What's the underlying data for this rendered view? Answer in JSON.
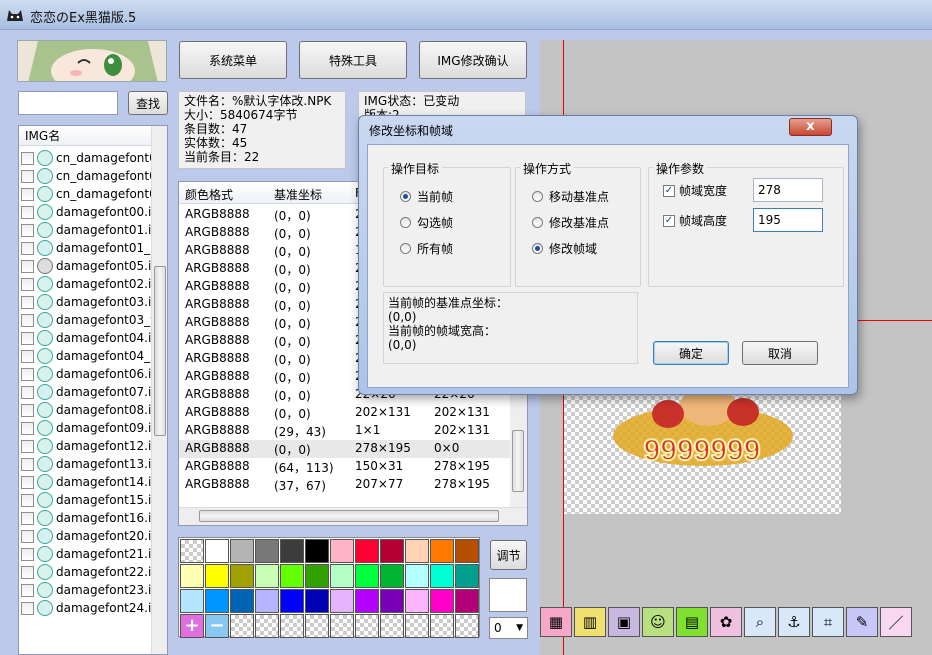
{
  "window": {
    "title": "恋恋のEx黑猫版.5"
  },
  "toolbar_buttons": {
    "system_menu": "系统菜单",
    "special_tools": "特殊工具",
    "img_confirm": "IMG修改确认"
  },
  "search": {
    "value": "",
    "button": "查找"
  },
  "img_list": {
    "header": "IMG名",
    "items": [
      {
        "name": "cn_damagefont0",
        "icon": "cat-icon"
      },
      {
        "name": "cn_damagefont0",
        "icon": "cat-icon"
      },
      {
        "name": "cn_damagefont0",
        "icon": "cat-icon"
      },
      {
        "name": "damagefont00.im",
        "icon": "cat-icon"
      },
      {
        "name": "damagefont01.im",
        "icon": "cat-icon"
      },
      {
        "name": "damagefont01_b",
        "icon": "cat-icon"
      },
      {
        "name": "damagefont05.im",
        "icon": "gray-cat-icon"
      },
      {
        "name": "damagefont02.im",
        "icon": "cat-icon"
      },
      {
        "name": "damagefont03.im",
        "icon": "cat-icon"
      },
      {
        "name": "damagefont03_v",
        "icon": "cat-icon"
      },
      {
        "name": "damagefont04.im",
        "icon": "cat-icon"
      },
      {
        "name": "damagefont04_r",
        "icon": "cat-icon"
      },
      {
        "name": "damagefont06.im",
        "icon": "cat-icon"
      },
      {
        "name": "damagefont07.im",
        "icon": "cat-icon"
      },
      {
        "name": "damagefont08.im",
        "icon": "cat-icon"
      },
      {
        "name": "damagefont09.im",
        "icon": "cat-icon"
      },
      {
        "name": "damagefont12.im",
        "icon": "cat-icon"
      },
      {
        "name": "damagefont13.im",
        "icon": "cat-icon"
      },
      {
        "name": "damagefont14.im",
        "icon": "cat-icon"
      },
      {
        "name": "damagefont15.im",
        "icon": "cat-icon"
      },
      {
        "name": "damagefont16.im",
        "icon": "cat-icon"
      },
      {
        "name": "damagefont20.im",
        "icon": "cat-icon"
      },
      {
        "name": "damagefont21.im",
        "icon": "cat-icon"
      },
      {
        "name": "damagefont22.im",
        "icon": "cat-icon"
      },
      {
        "name": "damagefont23.im",
        "icon": "cat-icon"
      },
      {
        "name": "damagefont24.im",
        "icon": "cat-icon"
      }
    ]
  },
  "npk_info": {
    "file": "文件名：%默认字体改.NPK",
    "size": "大小：5840674字节",
    "entries": "条目数：47",
    "entities": "实体数：45",
    "current": "当前条目：22"
  },
  "img_info": {
    "status": "IMG状态：已变动",
    "version": "版本:2"
  },
  "frames": {
    "headers": [
      "颜色格式",
      "基准坐标",
      "",
      ""
    ],
    "rows": [
      [
        "ARGB8888",
        "(0，0)",
        "2",
        ""
      ],
      [
        "ARGB8888",
        "(0，0)",
        "2",
        ""
      ],
      [
        "ARGB8888",
        "(0，0)",
        "1",
        ""
      ],
      [
        "ARGB8888",
        "(0，0)",
        "2",
        ""
      ],
      [
        "ARGB8888",
        "(0，0)",
        "2",
        ""
      ],
      [
        "ARGB8888",
        "(0，0)",
        "2",
        ""
      ],
      [
        "ARGB8888",
        "(0，0)",
        "2",
        ""
      ],
      [
        "ARGB8888",
        "(0，0)",
        "2",
        ""
      ],
      [
        "ARGB8888",
        "(0，0)",
        "2",
        ""
      ],
      [
        "ARGB8888",
        "(0，0)",
        "22×26",
        "22×26"
      ],
      [
        "ARGB8888",
        "(0，0)",
        "22×26",
        "22×26"
      ],
      [
        "ARGB8888",
        "(0，0)",
        "202×131",
        "202×131"
      ],
      [
        "ARGB8888",
        "(29，43)",
        "1×1",
        "202×131"
      ],
      [
        "ARGB8888",
        "(0，0)",
        "278×195",
        "0×0"
      ],
      [
        "ARGB8888",
        "(64，113)",
        "150×31",
        "278×195"
      ],
      [
        "ARGB8888",
        "(37，67)",
        "207×77",
        "278×195"
      ]
    ]
  },
  "palette": {
    "colors": [
      [
        "checker",
        "#ffffff",
        "#b4b4b4",
        "#787878",
        "#3c3c3c",
        "#000000",
        "#ffb4c8",
        "#ff0032",
        "#b40032",
        "#ffd2b4",
        "#ff7800",
        "#b45000"
      ],
      [
        "#ffffb4",
        "#ffff00",
        "#a0a000",
        "#c8ffb4",
        "#64ff00",
        "#32a000",
        "#b4ffc8",
        "#00ff3c",
        "#00b432",
        "#b4ffff",
        "#00ffd2",
        "#00a08c"
      ],
      [
        "#b4e6ff",
        "#0096ff",
        "#0064b4",
        "#b4b4ff",
        "#0000ff",
        "#0000b4",
        "#e6b4ff",
        "#b400ff",
        "#7800b4",
        "#ffb4ff",
        "#ff00c8",
        "#b40078"
      ],
      [
        "plus",
        "minus",
        "checker",
        "checker",
        "checker",
        "checker",
        "checker",
        "checker",
        "checker",
        "checker",
        "checker",
        "checker"
      ]
    ],
    "adjust_button": "调节",
    "combo_value": "0"
  },
  "dialog": {
    "title": "修改坐标和帧域",
    "close": "x",
    "target_group": "操作目标",
    "targets": [
      "当前帧",
      "勾选帧",
      "所有帧"
    ],
    "method_group": "操作方式",
    "methods": [
      "移动基准点",
      "修改基准点",
      "修改帧域"
    ],
    "params_group": "操作参数",
    "width_label": "帧域宽度",
    "width_value": "278",
    "height_label": "帧域高度",
    "height_value": "195",
    "info_line1": "当前帧的基准点坐标：",
    "info_line2": "(0,0)",
    "info_line3": "当前帧的帧域宽高：",
    "info_line4": "(0,0)",
    "ok": "确定",
    "cancel": "取消"
  },
  "sprite_text": "9999999",
  "tool_icons": [
    "frame-edit-icon",
    "palette-tool-icon",
    "film-icon",
    "cat-tool-icon",
    "film2-icon",
    "paw-icon",
    "zoom-icon",
    "anchor-icon",
    "crop-icon",
    "pen-icon",
    "line-icon"
  ]
}
